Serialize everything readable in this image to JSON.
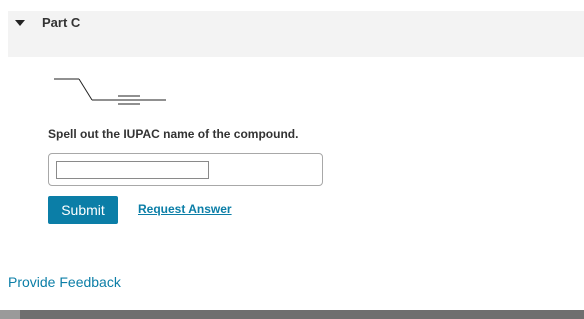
{
  "part": {
    "title": "Part C",
    "toggle_icon": "triangle-down-icon"
  },
  "question": {
    "prompt": "Spell out the IUPAC name of the compound.",
    "answer_value": "",
    "answer_placeholder": ""
  },
  "actions": {
    "submit_label": "Submit",
    "request_answer_label": "Request Answer"
  },
  "footer": {
    "feedback_label": "Provide Feedback"
  },
  "colors": {
    "accent": "#0b7ea7",
    "header_bg": "#f3f3f3"
  }
}
